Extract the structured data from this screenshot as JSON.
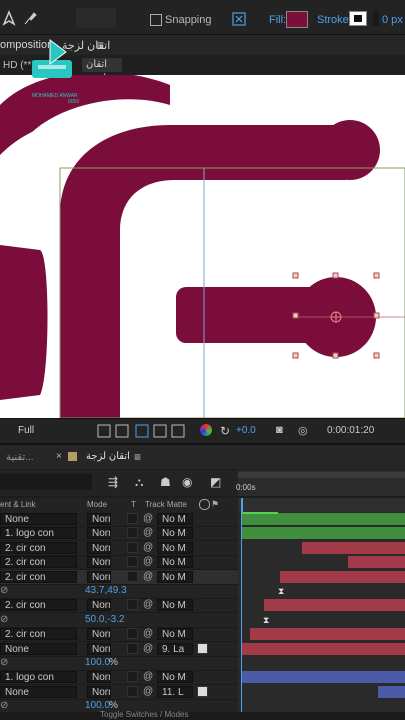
{
  "toolbar": {
    "snapping_label": "Snapping",
    "fill_label": "Fill:",
    "fill_color": "#7a0f3a",
    "stroke_label": "Stroke:",
    "stroke_width": "0 px"
  },
  "comp_panel": {
    "title": "omposition",
    "tab_name": "اتقان لزجة",
    "menu_icon": "menu-icon",
    "sub_label": "HD (**)",
    "sub_tab": "اتقان لزجة"
  },
  "watermark": {
    "logo_text": "MOHAMED ANWAR",
    "number": "0055"
  },
  "viewer": {
    "shape_color": "#7b0d3b"
  },
  "view_controls": {
    "quality": "Full",
    "exposure": "+0.0",
    "timecode": "0:00:01:20"
  },
  "timeline": {
    "left_tab": "تقنية...",
    "comp_tab": "اتقان لزجة",
    "time_marker": "0:00s",
    "columns": {
      "parent": "ent & Link",
      "mode": "Mode",
      "t": "T",
      "track_matte": "Track Matte"
    },
    "rows": [
      {
        "parent": "None",
        "mode": "Norn",
        "matte": "No M",
        "kind": "layer"
      },
      {
        "parent": "1. logo con",
        "mode": "Norn",
        "matte": "No M",
        "kind": "layer"
      },
      {
        "parent": "2. cir con",
        "mode": "Norn",
        "matte": "No M",
        "kind": "layer"
      },
      {
        "parent": "2. cir con",
        "mode": "Norn",
        "matte": "No M",
        "kind": "layer"
      },
      {
        "parent": "2. cir con",
        "mode": "Norn",
        "matte": "No M",
        "kind": "layer"
      },
      {
        "value": "43.7,49.3",
        "kind": "prop"
      },
      {
        "parent": "2. cir con",
        "mode": "Norn",
        "matte": "No M",
        "kind": "layer"
      },
      {
        "value": "50.0,-3.2",
        "kind": "prop"
      },
      {
        "parent": "2. cir con",
        "mode": "Norn",
        "matte": "No M",
        "kind": "layer"
      },
      {
        "parent": "None",
        "mode": "Norn",
        "matte": "9. La",
        "kind": "layer"
      },
      {
        "value": "100.0",
        "unit": "%",
        "kind": "prop"
      },
      {
        "parent": "1. logo con",
        "mode": "Norn",
        "matte": "No M",
        "kind": "layer"
      },
      {
        "parent": "None",
        "mode": "Norn",
        "matte": "11. L",
        "kind": "layer"
      },
      {
        "value": "100.0",
        "unit": "%",
        "kind": "prop"
      }
    ],
    "footer": "Toggle Switches / Modes"
  },
  "track_colors": {
    "green": "#3f8f3f",
    "red": "#a23a48",
    "blue": "#4b5ba8"
  }
}
